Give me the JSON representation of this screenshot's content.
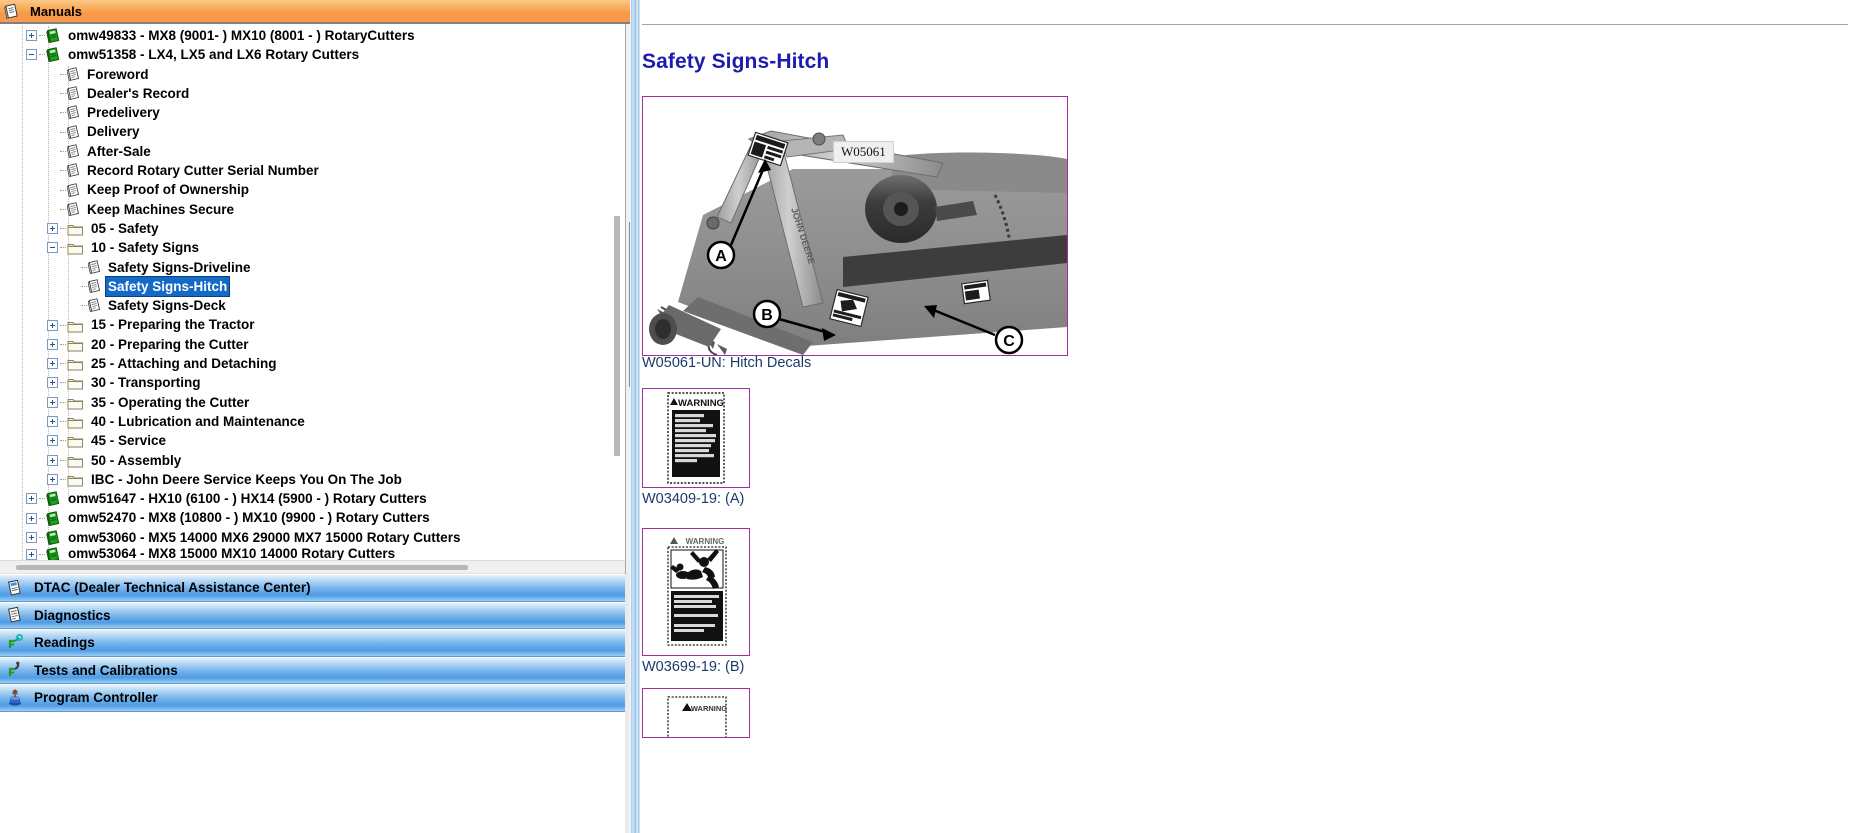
{
  "window": {
    "manuals_header": {
      "label": "Manuals",
      "icon": "manual-book-icon",
      "bg_color": "#f8994a"
    }
  },
  "tree": {
    "selected_item": "Safety Signs-Hitch",
    "selection_color": "#1569c7",
    "items": [
      {
        "label": "omw49833 - MX8  (9001-                ) MX10 (8001 -                 ) RotaryCutters",
        "depth": 1,
        "icon": "green-book-icon",
        "expander": "plus"
      },
      {
        "label": "omw51358 - LX4, LX5 and LX6  Rotary Cutters",
        "depth": 1,
        "icon": "green-book-icon",
        "expander": "minus"
      },
      {
        "label": "Foreword",
        "depth": 2,
        "icon": "document-icon",
        "expander": "none"
      },
      {
        "label": "Dealer's Record",
        "depth": 2,
        "icon": "document-icon",
        "expander": "none"
      },
      {
        "label": "Predelivery",
        "depth": 2,
        "icon": "document-icon",
        "expander": "none"
      },
      {
        "label": "Delivery",
        "depth": 2,
        "icon": "document-icon",
        "expander": "none"
      },
      {
        "label": "After-Sale",
        "depth": 2,
        "icon": "document-icon",
        "expander": "none"
      },
      {
        "label": "Record Rotary Cutter Serial Number",
        "depth": 2,
        "icon": "document-icon",
        "expander": "none"
      },
      {
        "label": "Keep Proof of Ownership",
        "depth": 2,
        "icon": "document-icon",
        "expander": "none"
      },
      {
        "label": "Keep Machines Secure",
        "depth": 2,
        "icon": "document-icon",
        "expander": "none"
      },
      {
        "label": "05 - Safety",
        "depth": 2,
        "icon": "folder-icon",
        "expander": "plus"
      },
      {
        "label": "10 - Safety Signs",
        "depth": 2,
        "icon": "folder-icon",
        "expander": "minus"
      },
      {
        "label": "Safety Signs-Driveline",
        "depth": 3,
        "icon": "document-icon",
        "expander": "none"
      },
      {
        "label": "Safety Signs-Hitch",
        "depth": 3,
        "icon": "document-icon",
        "expander": "none",
        "selected": true
      },
      {
        "label": "Safety Signs-Deck",
        "depth": 3,
        "icon": "document-icon",
        "expander": "none"
      },
      {
        "label": "15 - Preparing the Tractor",
        "depth": 2,
        "icon": "folder-icon",
        "expander": "plus"
      },
      {
        "label": "20 - Preparing the Cutter",
        "depth": 2,
        "icon": "folder-icon",
        "expander": "plus"
      },
      {
        "label": "25 - Attaching and Detaching",
        "depth": 2,
        "icon": "folder-icon",
        "expander": "plus"
      },
      {
        "label": "30 - Transporting",
        "depth": 2,
        "icon": "folder-icon",
        "expander": "plus"
      },
      {
        "label": "35 - Operating the Cutter",
        "depth": 2,
        "icon": "folder-icon",
        "expander": "plus"
      },
      {
        "label": "40 - Lubrication and Maintenance",
        "depth": 2,
        "icon": "folder-icon",
        "expander": "plus"
      },
      {
        "label": "45 - Service",
        "depth": 2,
        "icon": "folder-icon",
        "expander": "plus"
      },
      {
        "label": "50 - Assembly",
        "depth": 2,
        "icon": "folder-icon",
        "expander": "plus"
      },
      {
        "label": "IBC - John Deere Service Keeps You On The Job",
        "depth": 2,
        "icon": "folder-icon",
        "expander": "plus"
      },
      {
        "label": "omw51647 - HX10 (6100 - ) HX14 (5900 - ) Rotary Cutters",
        "depth": 1,
        "icon": "green-book-icon",
        "expander": "plus"
      },
      {
        "label": "omw52470 - MX8 (10800 -   ) MX10 (9900 -    ) Rotary Cutters",
        "depth": 1,
        "icon": "green-book-icon",
        "expander": "plus"
      },
      {
        "label": "omw53060 - MX5  14000  MX6  29000  MX7  15000  Rotary Cutters",
        "depth": 1,
        "icon": "green-book-icon",
        "expander": "plus"
      },
      {
        "label": "omw53064 - MX8 15000 MX10 14000 Rotary Cutters",
        "depth": 1,
        "icon": "green-book-icon",
        "expander": "plus",
        "clipped": true
      }
    ]
  },
  "nav_bars": [
    {
      "label": "DTAC (Dealer Technical Assistance Center)",
      "icon": "dtac-icon"
    },
    {
      "label": "Diagnostics",
      "icon": "diagnostics-icon"
    },
    {
      "label": "Readings",
      "icon": "readings-icon"
    },
    {
      "label": "Tests and Calibrations",
      "icon": "tests-calibrations-icon"
    },
    {
      "label": "Program Controller",
      "icon": "program-controller-icon"
    }
  ],
  "content": {
    "title": "Safety Signs-Hitch",
    "title_color": "#1c1cb0",
    "figure_border_color": "#a030a0",
    "main_figure": {
      "callout_label": "W05061",
      "markers": [
        "A",
        "B",
        "C"
      ],
      "caption": "W05061-UN: Hitch Decals",
      "alt": "Black and white photo of rotary cutter hitch showing locations of decals A, B and C"
    },
    "decals": [
      {
        "caption": "W03409-19: (A)",
        "header": "WARNING",
        "body_lines": [
          "Rotary cutter",
          "slowly after",
          "connecting P.T.O.",
          "to power take",
          "prevent drift over",
          "see slides cover",
          "frame. If there is",
          "any maintenance",
          "see Operator's",
          "Manual."
        ]
      },
      {
        "caption": "W03699-19: (B)",
        "header": "WARNING",
        "body_lines": [
          "Entanglement in rotating",
          "driveline can cause",
          "serious injury or death.",
          "Keep all shields in place",
          "Avoid contact with",
          "rotating parts."
        ]
      },
      {
        "caption": "",
        "header": "WARNING",
        "body_lines": []
      }
    ]
  }
}
